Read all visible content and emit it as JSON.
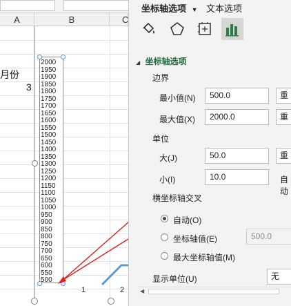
{
  "sheet": {
    "columns": [
      "A",
      "B",
      "C"
    ],
    "cell_a_label": "月份",
    "cell_a_value": "3",
    "axis_ticks": [
      "2000",
      "1950",
      "1900",
      "1850",
      "1800",
      "1750",
      "1700",
      "1650",
      "1600",
      "1550",
      "1500",
      "1450",
      "1400",
      "1350",
      "1300",
      "1250",
      "1200",
      "1150",
      "1100",
      "1050",
      "1000",
      "950",
      "900",
      "850",
      "800",
      "750",
      "700",
      "650",
      "600",
      "550",
      "500"
    ],
    "category_labels": [
      "1",
      "2"
    ]
  },
  "panel": {
    "tabs": [
      "坐标轴选项",
      "文本选项"
    ],
    "section_title": "坐标轴选项",
    "bounds_label": "边界",
    "min_label": "最小值(N)",
    "min_value": "500.0",
    "max_label": "最大值(X)",
    "max_value": "2000.0",
    "reset_label": "重置",
    "units_label": "单位",
    "major_label": "大(J)",
    "major_value": "50.0",
    "minor_label": "小(I)",
    "minor_value": "10.0",
    "auto_label": "自动",
    "cross_label": "横坐标轴交叉",
    "cross_options": [
      "自动(O)",
      "坐标轴值(E)",
      "最大坐标轴值(M)"
    ],
    "cross_selected": 0,
    "cross_value": "500.0",
    "display_units_label": "显示单位(U)",
    "display_units_value": "无"
  },
  "colors": {
    "arrow": "#e02020",
    "series_line": "#5b9bd5",
    "section_green": "#1d6a3a",
    "chart_icon_green": "#2e7d46"
  }
}
